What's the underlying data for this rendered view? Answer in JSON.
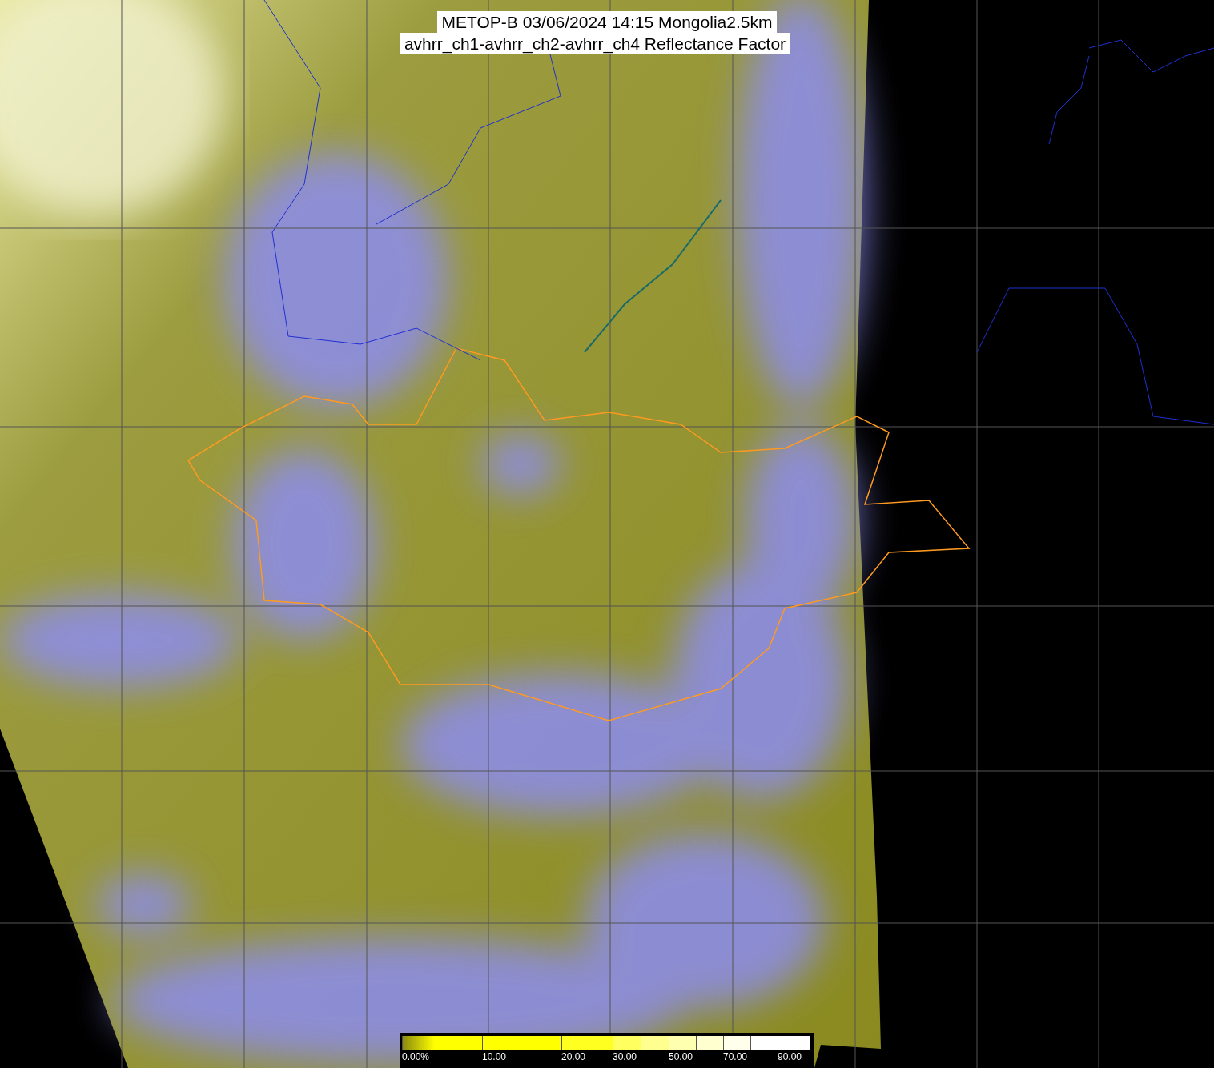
{
  "title_lines": [
    "METOP-B 03/06/2024 14:15 Mongolia2.5km",
    "avhrr_ch1-avhrr_ch2-avhrr_ch4 Reflectance Factor"
  ],
  "colorbar": {
    "segments": [
      {
        "color": "#ffff00"
      },
      {
        "color": "#ffff00"
      },
      {
        "color": "#ffff20"
      },
      {
        "color": "#ffff60"
      },
      {
        "color": "#ffff90"
      },
      {
        "color": "#ffffb0"
      },
      {
        "color": "#ffffd0"
      },
      {
        "color": "#ffffec"
      },
      {
        "color": "#ffffff"
      },
      {
        "color": "#ffffff"
      }
    ],
    "labels": [
      "0.00%",
      "10.00",
      "20.00",
      "30.00",
      "50.00",
      "70.00",
      "90.00"
    ]
  }
}
